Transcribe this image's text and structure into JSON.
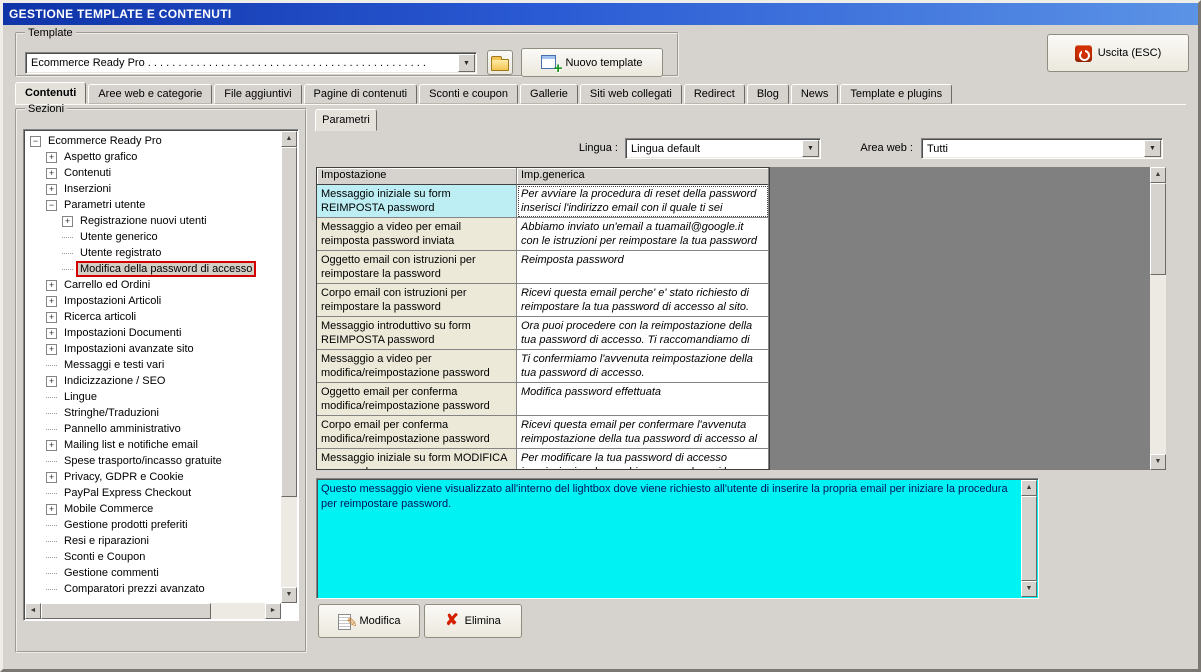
{
  "window": {
    "title": "GESTIONE TEMPLATE E CONTENUTI"
  },
  "toolbar": {
    "group_label": "Template",
    "template_value": "Ecommerce Ready Pro  . . . . . . . . . . . . . . . . . . . . . . . . . . . . . . . . . . . . . . . . . . . . . .",
    "new_template_label": "Nuovo template",
    "exit_label": "Uscita (ESC)"
  },
  "tabs": [
    {
      "label": "Contenuti",
      "active": true
    },
    {
      "label": "Aree web e categorie",
      "active": false
    },
    {
      "label": "File aggiuntivi",
      "active": false
    },
    {
      "label": "Pagine di contenuti",
      "active": false
    },
    {
      "label": "Sconti e coupon",
      "active": false
    },
    {
      "label": "Gallerie",
      "active": false
    },
    {
      "label": "Siti web collegati",
      "active": false
    },
    {
      "label": "Redirect",
      "active": false
    },
    {
      "label": "Blog",
      "active": false
    },
    {
      "label": "News",
      "active": false
    },
    {
      "label": "Template e plugins",
      "active": false
    }
  ],
  "sezioni": {
    "group_label": "Sezioni",
    "items": [
      {
        "label": "Ecommerce Ready Pro",
        "level": 0,
        "expander": "minus",
        "selected": false
      },
      {
        "label": "Aspetto grafico",
        "level": 1,
        "expander": "plus",
        "selected": false
      },
      {
        "label": "Contenuti",
        "level": 1,
        "expander": "plus",
        "selected": false
      },
      {
        "label": "Inserzioni",
        "level": 1,
        "expander": "plus",
        "selected": false
      },
      {
        "label": "Parametri utente",
        "level": 1,
        "expander": "minus",
        "selected": false
      },
      {
        "label": "Registrazione nuovi utenti",
        "level": 2,
        "expander": "plus",
        "selected": false
      },
      {
        "label": "Utente generico",
        "level": 2,
        "expander": "none",
        "selected": false
      },
      {
        "label": "Utente registrato",
        "level": 2,
        "expander": "none",
        "selected": false
      },
      {
        "label": "Modifica della password di accesso",
        "level": 2,
        "expander": "none",
        "selected": true
      },
      {
        "label": "Carrello ed Ordini",
        "level": 1,
        "expander": "plus",
        "selected": false
      },
      {
        "label": "Impostazioni Articoli",
        "level": 1,
        "expander": "plus",
        "selected": false
      },
      {
        "label": "Ricerca articoli",
        "level": 1,
        "expander": "plus",
        "selected": false
      },
      {
        "label": "Impostazioni Documenti",
        "level": 1,
        "expander": "plus",
        "selected": false
      },
      {
        "label": "Impostazioni avanzate sito",
        "level": 1,
        "expander": "plus",
        "selected": false
      },
      {
        "label": "Messaggi e testi vari",
        "level": 1,
        "expander": "none",
        "selected": false
      },
      {
        "label": "Indicizzazione / SEO",
        "level": 1,
        "expander": "plus",
        "selected": false
      },
      {
        "label": "Lingue",
        "level": 1,
        "expander": "none",
        "selected": false
      },
      {
        "label": "Stringhe/Traduzioni",
        "level": 1,
        "expander": "none",
        "selected": false
      },
      {
        "label": "Pannello amministrativo",
        "level": 1,
        "expander": "none",
        "selected": false
      },
      {
        "label": "Mailing list e notifiche email",
        "level": 1,
        "expander": "plus",
        "selected": false
      },
      {
        "label": "Spese trasporto/incasso gratuite",
        "level": 1,
        "expander": "none",
        "selected": false
      },
      {
        "label": "Privacy, GDPR e Cookie",
        "level": 1,
        "expander": "plus",
        "selected": false
      },
      {
        "label": "PayPal Express Checkout",
        "level": 1,
        "expander": "none",
        "selected": false
      },
      {
        "label": "Mobile Commerce",
        "level": 1,
        "expander": "plus",
        "selected": false
      },
      {
        "label": "Gestione prodotti preferiti",
        "level": 1,
        "expander": "none",
        "selected": false
      },
      {
        "label": "Resi e riparazioni",
        "level": 1,
        "expander": "none",
        "selected": false
      },
      {
        "label": "Sconti e Coupon",
        "level": 1,
        "expander": "none",
        "selected": false
      },
      {
        "label": "Gestione commenti",
        "level": 1,
        "expander": "none",
        "selected": false
      },
      {
        "label": "Comparatori prezzi avanzato",
        "level": 1,
        "expander": "none",
        "selected": false
      }
    ]
  },
  "parametri": {
    "tab_label": "Parametri",
    "lingua_label": "Lingua :",
    "lingua_value": "Lingua default",
    "area_web_label": "Area web :",
    "area_web_value": "Tutti",
    "table": {
      "columns": [
        "Impostazione",
        "Imp.generica"
      ],
      "rows": [
        {
          "name": "Messaggio iniziale su form REIMPOSTA password",
          "value": "Per avviare la procedura di reset della password inserisci l'indirizzo email con il quale ti sei registrato.",
          "selected": true
        },
        {
          "name": "Messaggio a video per email reimposta password inviata",
          "value": "Abbiamo inviato un'email a tuamail@google.it con le istruzioni per reimpostare la tua password di a...",
          "selected": false
        },
        {
          "name": "Oggetto email con istruzioni per reimpostare la password",
          "value": "Reimposta password",
          "selected": false
        },
        {
          "name": "Corpo email con istruzioni per reimpostare la password",
          "value": "Ricevi questa email perche' e' stato richiesto di reimpostare la tua password di accesso al sito. P...",
          "selected": false
        },
        {
          "name": "Messaggio introduttivo su form REIMPOSTA password",
          "value": "Ora puoi procedere con la reimpostazione della tua password di accesso. Ti raccomandiamo di utilizz...",
          "selected": false
        },
        {
          "name": "Messaggio a video per modifica/reimpostazione password eff...",
          "value": "Ti confermiamo l'avvenuta reimpostazione della tua password di accesso.",
          "selected": false
        },
        {
          "name": "Oggetto email per conferma modifica/reimpostazione password",
          "value": "Modifica password effettuata",
          "selected": false
        },
        {
          "name": "Corpo email per conferma modifica/reimpostazione password",
          "value": "Ricevi questa email per confermare l'avvenuta reimpostazione della tua password di accesso al ...",
          "selected": false
        },
        {
          "name": "Messaggio iniziale su form MODIFICA password",
          "value": "Per modificare la tua password di accesso inserisci prima la vecchia password e poi la nuova...",
          "selected": false
        }
      ]
    },
    "description": "Questo messaggio viene visualizzato all'interno del lightbox dove viene richiesto all'utente di inserire la propria email per iniziare la procedura per reimpostare password.",
    "modifica_label": "Modifica",
    "elimina_label": "Elimina"
  },
  "colors": {
    "titlebar_blue": "#2a5ad4",
    "selection_cyan": "#bdeef4",
    "description_cyan": "#00f2f2",
    "highlight_red": "#d40000",
    "preview_gray": "#808080"
  }
}
